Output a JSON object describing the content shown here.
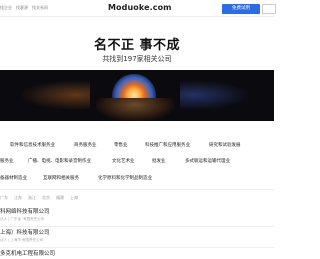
{
  "topbar": {
    "links": [
      "找企业",
      "找客源",
      "找关系网"
    ],
    "logo": "Moduoke.com",
    "free_trial_label": "免费试用"
  },
  "hero": {
    "title": "名不正 事不成",
    "subtitle": "共找到197家相关公司"
  },
  "categories": {
    "row1": [
      "软件和信息技术服务业",
      "商务服务业",
      "零售业",
      "科技推广和应用服务业",
      "研究和试验发展"
    ],
    "row2": [
      "服务业",
      "广播、电视、电影和录音制作业",
      "文化艺术业",
      "批发业",
      "多式联运和运输代理业"
    ],
    "row3": [
      "备器材制造业",
      "互联网和相关服务",
      "化学原料和化学制品制造业"
    ]
  },
  "filters": [
    "广东",
    "江苏",
    "浙江",
    "北京",
    "福建",
    "上海"
  ],
  "companies": [
    {
      "name": "科网络科技有限公司",
      "meta": "法人 | 广东省 ·有限责任公司"
    },
    {
      "name": "上海）科技有限公司",
      "meta": "法人 | 上海市·有限责任公司"
    },
    {
      "name": "多克机电工程有限公司",
      "meta": ""
    }
  ]
}
